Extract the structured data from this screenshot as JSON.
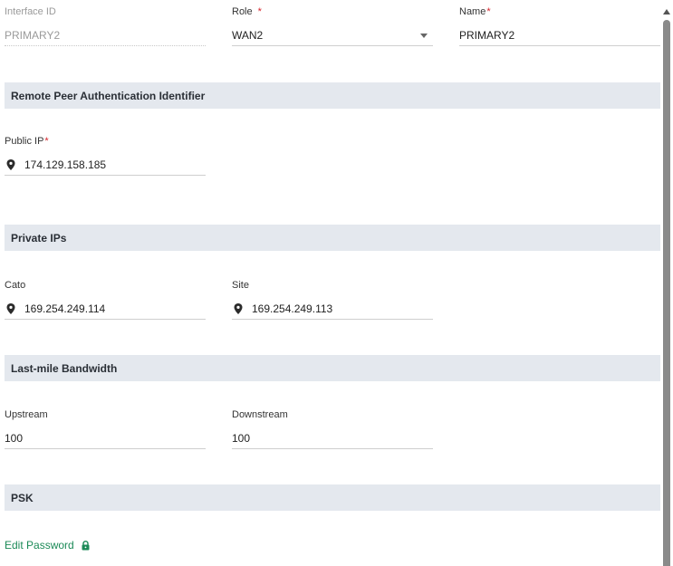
{
  "interface": {
    "id_label": "Interface ID",
    "id_value": "PRIMARY2",
    "role_label": "Role",
    "role_required": "*",
    "role_value": "WAN2",
    "name_label": "Name",
    "name_required": "*",
    "name_value": "PRIMARY2"
  },
  "remote_peer": {
    "section_title": "Remote Peer Authentication Identifier",
    "public_ip_label": "Public IP",
    "public_ip_required": "*",
    "public_ip_value": "174.129.158.185"
  },
  "private_ips": {
    "section_title": "Private IPs",
    "cato_label": "Cato",
    "cato_value": "169.254.249.114",
    "site_label": "Site",
    "site_value": "169.254.249.113"
  },
  "bandwidth": {
    "section_title": "Last-mile Bandwidth",
    "upstream_label": "Upstream",
    "upstream_value": "100",
    "downstream_label": "Downstream",
    "downstream_value": "100"
  },
  "psk": {
    "section_title": "PSK",
    "edit_password_label": "Edit Password"
  },
  "icons": {
    "location": "location-pin-icon",
    "lock": "lock-icon",
    "dropdown": "caret-down-icon",
    "scroll_up": "scroll-up-arrow-icon"
  },
  "colors": {
    "section_bg": "#e4e8ee",
    "required": "#d6242b",
    "link": "#1b8a57"
  }
}
